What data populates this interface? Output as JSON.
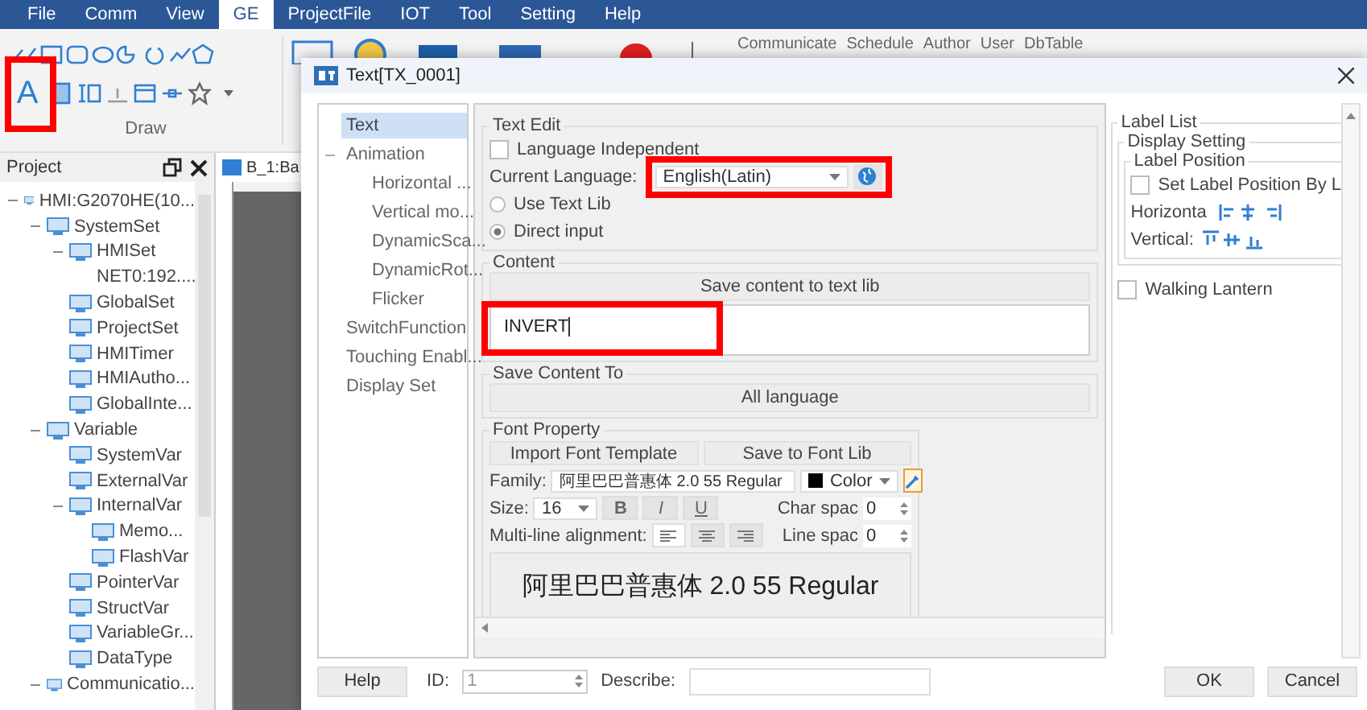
{
  "menu": [
    {
      "label": "File",
      "selected": false
    },
    {
      "label": "Comm",
      "selected": false
    },
    {
      "label": "View",
      "selected": false
    },
    {
      "label": "GE",
      "selected": true
    },
    {
      "label": "ProjectFile",
      "selected": false
    },
    {
      "label": "IOT",
      "selected": false
    },
    {
      "label": "Tool",
      "selected": false
    },
    {
      "label": "Setting",
      "selected": false
    },
    {
      "label": "Help",
      "selected": false
    }
  ],
  "ribbon": {
    "text_tool": "A",
    "group_label": "Draw",
    "quick_links": [
      "Communicate",
      "Schedule",
      "Author",
      "User",
      "DbTable"
    ]
  },
  "project_panel": {
    "title": "Project",
    "tree": [
      {
        "label": "HMI:G2070HE(10...",
        "expanded": true,
        "children": [
          {
            "label": "SystemSet",
            "expanded": true,
            "children": [
              {
                "label": "HMISet",
                "expanded": true,
                "children": [
                  {
                    "label": "NET0:192...."
                  }
                ]
              },
              {
                "label": "GlobalSet"
              },
              {
                "label": "ProjectSet"
              },
              {
                "label": "HMITimer"
              },
              {
                "label": "HMIAutho..."
              },
              {
                "label": "GlobalInte..."
              }
            ]
          },
          {
            "label": "Variable",
            "expanded": true,
            "children": [
              {
                "label": "SystemVar"
              },
              {
                "label": "ExternalVar"
              },
              {
                "label": "InternalVar",
                "expanded": true,
                "children": [
                  {
                    "label": "Memo..."
                  },
                  {
                    "label": "FlashVar"
                  }
                ]
              },
              {
                "label": "PointerVar"
              },
              {
                "label": "StructVar"
              },
              {
                "label": "VariableGr..."
              },
              {
                "label": "DataType"
              }
            ]
          },
          {
            "label": "Communicatio...",
            "expanded": true
          }
        ]
      }
    ]
  },
  "canvas_tab": {
    "label": "B_1:Ba"
  },
  "dialog": {
    "title": "Text[TX_0001]",
    "nav": [
      {
        "label": "Text",
        "selected": true
      },
      {
        "label": "Animation",
        "selected": false,
        "expanded": true,
        "children": [
          {
            "label": "Horizontal ...",
            "selected": false
          },
          {
            "label": "Vertical mo...",
            "selected": false
          },
          {
            "label": "DynamicSca...",
            "selected": false
          },
          {
            "label": "DynamicRot...",
            "selected": false
          },
          {
            "label": "Flicker",
            "selected": false
          }
        ]
      },
      {
        "label": "SwitchFunction",
        "selected": false
      },
      {
        "label": "Touching Enabl...",
        "selected": false
      },
      {
        "label": "Display Set",
        "selected": false
      }
    ],
    "text_edit": {
      "title": "Text Edit",
      "language_independent": {
        "label": "Language Independent",
        "checked": false
      },
      "current_language": {
        "label": "Current Language:",
        "value": "English(Latin)"
      },
      "source_options": [
        {
          "label": "Use Text Lib",
          "selected": false
        },
        {
          "label": "Direct input",
          "selected": true
        }
      ]
    },
    "content": {
      "title": "Content",
      "save_button": "Save content to text lib",
      "value": "INVERT"
    },
    "save_content_to": {
      "title": "Save Content To",
      "button": "All language"
    },
    "font_property": {
      "title": "Font Property",
      "buttons": [
        "Import  Font Template",
        "Save to Font Lib"
      ],
      "family_label": "Family:",
      "family": "阿里巴巴普惠体 2.0 55 Regular",
      "color_label": "Color",
      "size_label": "Size:",
      "size": "16",
      "styles": [
        {
          "label": "B",
          "on": false
        },
        {
          "label": "I",
          "on": false
        },
        {
          "label": "U",
          "on": false
        }
      ],
      "char_spacing_label": "Char spac",
      "char_spacing": "0",
      "alignment_label": "Multi-line alignment:",
      "alignments": [
        {
          "kind": "left",
          "selected": true
        },
        {
          "kind": "center",
          "selected": false
        },
        {
          "kind": "right",
          "selected": false
        }
      ],
      "line_spacing_label": "Line spac",
      "line_spacing": "0",
      "preview": "阿里巴巴普惠体 2.0 55 Regular"
    },
    "label_list": {
      "title": "Label List",
      "display_setting": "Display Setting",
      "label_position": "Label Position",
      "set_by_label": {
        "label": "Set Label Position By L",
        "checked": false
      },
      "horizontal_label": "Horizonta",
      "vertical_label": "Vertical:",
      "walking_lantern": {
        "label": "Walking Lantern",
        "checked": false
      }
    },
    "footer": {
      "help": "Help",
      "id_label": "ID:",
      "id_value": "1",
      "describe_label": "Describe:",
      "ok": "OK",
      "cancel": "Cancel"
    }
  }
}
